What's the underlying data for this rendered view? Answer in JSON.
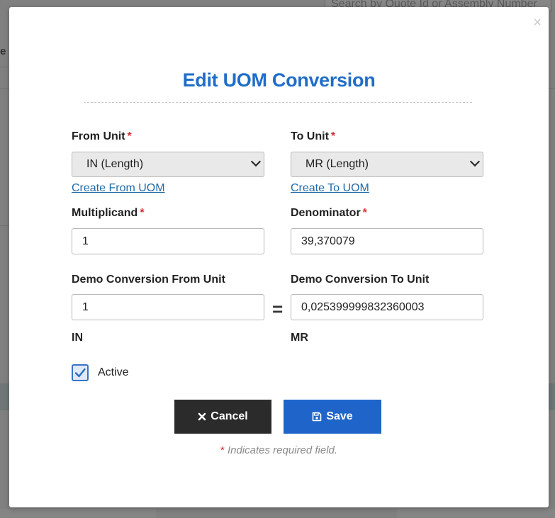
{
  "background": {
    "search_placeholder": "Search by Quote Id or Assembly Number",
    "partial_letter": "e"
  },
  "modal": {
    "close_glyph": "×",
    "title": "Edit UOM Conversion",
    "from_unit": {
      "label": "From Unit",
      "required_mark": "*",
      "selected": "IN (Length)",
      "create_link": "Create From UOM"
    },
    "to_unit": {
      "label": "To Unit",
      "required_mark": "*",
      "selected": "MR (Length)",
      "create_link": "Create To UOM"
    },
    "multiplicand": {
      "label": "Multiplicand",
      "required_mark": "*",
      "value": "1"
    },
    "denominator": {
      "label": "Denominator",
      "required_mark": "*",
      "value": "39,370079"
    },
    "demo_from": {
      "label": "Demo Conversion From Unit",
      "value": "1",
      "unit": "IN"
    },
    "equals_sign": "=",
    "demo_to": {
      "label": "Demo Conversion To Unit",
      "value": "0,025399999832360003",
      "unit": "MR"
    },
    "active": {
      "label": "Active",
      "checked": true
    },
    "buttons": {
      "cancel": "Cancel",
      "cancel_icon": "times-icon",
      "save": "Save",
      "save_icon": "floppy-disk-icon"
    },
    "footnote": {
      "star": "*",
      "text": " Indicates required field."
    }
  },
  "colors": {
    "title": "#1f6dc8",
    "required": "#d9303a",
    "link": "#1f6aa8",
    "save_button": "#1f65c9",
    "cancel_button": "#2b2b2b",
    "overlay": "#808080"
  }
}
